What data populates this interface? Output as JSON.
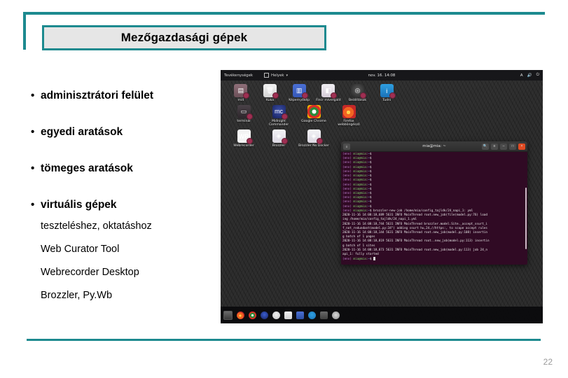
{
  "slide": {
    "title": "Mezőgazdasági gépek",
    "page_number": "22",
    "accent_color": "#1d8a8f",
    "title_fill": "#e6e6e6"
  },
  "bullets": [
    {
      "marker": "•",
      "text": "adminisztrátori felület"
    },
    {
      "marker": "•",
      "text": "egyedi aratások"
    },
    {
      "marker": "•",
      "text": "tömeges aratások"
    },
    {
      "marker": "•",
      "text": "virtuális gépek"
    }
  ],
  "sublines": [
    "teszteléshez, oktatáshoz",
    "Web Curator Tool",
    "Webrecorder Desktop",
    "Brozzler, Py.Wb"
  ],
  "screenshot": {
    "panel": {
      "activities": "Tevékenységek",
      "places": "Helyek",
      "places_icon": "folder-icon",
      "caret": "▾",
      "clock": "nov. 16. 14:08",
      "accessibility_icon": "A",
      "volume_icon": "🔊",
      "power_icon": "⏻"
    },
    "desktop_icons": [
      [
        {
          "label": "mi4",
          "glyph_class": "g-folder",
          "icon": "folder-icon",
          "symbol": "▤"
        },
        {
          "label": "Kuka",
          "glyph_class": "g-trash",
          "icon": "trash-icon",
          "symbol": "🗑"
        },
        {
          "label": "Képernyőkép",
          "glyph_class": "g-screen",
          "icon": "screenshot-icon",
          "symbol": "▥"
        },
        {
          "label": "Fincr mlvergalit",
          "glyph_class": "g-find",
          "icon": "find-icon",
          "symbol": "◧"
        },
        {
          "label": "Beállítások",
          "glyph_class": "g-settings",
          "icon": "settings-icon",
          "symbol": "◎"
        },
        {
          "label": "Tudni",
          "glyph_class": "g-info",
          "icon": "info-icon",
          "symbol": "i"
        }
      ],
      [
        {
          "label": "terminál",
          "glyph_class": "g-term",
          "icon": "terminal-icon",
          "symbol": "▭"
        },
        {
          "label": "Midnight Commander",
          "glyph_class": "g-mc",
          "icon": "midnight-commander-icon",
          "symbol": "mc"
        },
        {
          "label": "Google Chrome",
          "glyph_class": "g-chrome",
          "icon": "chrome-icon",
          "symbol": ""
        },
        {
          "label": "Firefox webböngésző",
          "glyph_class": "g-fox",
          "icon": "firefox-icon",
          "symbol": ""
        }
      ],
      [
        {
          "label": "Webrecorder",
          "glyph_class": "g-wr",
          "icon": "webrecorder-icon",
          "symbol": "WR"
        },
        {
          "label": "Brozzler",
          "glyph_class": "g-broz",
          "icon": "brozzler-icon",
          "symbol": "◈"
        },
        {
          "label": "Brozzler No Docker",
          "glyph_class": "g-broz",
          "icon": "brozzler-nodocker-icon",
          "symbol": "◈"
        }
      ]
    ],
    "terminal": {
      "title": "mia@mia: ~",
      "menu_icon": "hamburger-icon",
      "search_icon": "🔍",
      "minimize_label": "–",
      "maximize_label": "□",
      "close_label": "×",
      "prompt": "(env) mia@mia:~$",
      "lines": [
        "(env) mia@mia:~$ ",
        "(env) mia@mia:~$ ",
        "(env) mia@mia:~$ ",
        "(env) mia@mia:~$ ",
        "(env) mia@mia:~$ ",
        "(env) mia@mia:~$ ",
        "(env) mia@mia:~$ ",
        "(env) mia@mia:~$ ",
        "(env) mia@mia:~$ ",
        "(env) mia@mia:~$ ",
        "(env) mia@mia:~$ ",
        "(env) mia@mia:~$ ",
        "(env) mia@mia:~$ ",
        "(env) mia@mia:~$ brozzler-new-job /home/mia/config_tajldk/24_napi_1: yml",
        "2020-11-16 14:08:18,689 5631 INFO MainThread root.new_job(file(model.py:76) load",
        "ing /home/mia/config_tajldk/24_napi_1.yml",
        "2020-11-16 14:08:18,744 5631 INFO MainThread brozzler.model.Site._accept_ssurt_i",
        "f_not_redundant(model.py:34\") adding ssurt hu,24,//https:, to scope accept rules",
        "2020-11-16 14:08:18,144 5631 INFO MainThread root.new_job(model.py:108) insertin",
        "g batch of 1 pages",
        "2020-11-16 14:08:18,819 5631 INFO MainThread root..new_job(model.py:113) insertin",
        "g batch of 1 sites",
        "2020-11-16 14:08:18,873 5631 INFO MainThread root.new_job(model.py:113) job 24_n",
        "api_1: fully started",
        "(env) mia@mia:~$ "
      ]
    },
    "dock_items": [
      {
        "name": "show-applications",
        "class": "showapps",
        "symbol": "⠿"
      },
      {
        "name": "firefox",
        "class": "d-fox",
        "symbol": ""
      },
      {
        "name": "chrome",
        "class": "d-chrome",
        "symbol": ""
      },
      {
        "name": "thunderbird",
        "class": "d-mail",
        "symbol": ""
      },
      {
        "name": "disks",
        "class": "d-disk",
        "symbol": ""
      },
      {
        "name": "files",
        "class": "d-files",
        "symbol": ""
      },
      {
        "name": "text-editor",
        "class": "d-edit",
        "symbol": ""
      },
      {
        "name": "help",
        "class": "d-help",
        "symbol": ""
      },
      {
        "name": "software",
        "class": "d-soft",
        "symbol": ""
      },
      {
        "name": "settings",
        "class": "d-settings",
        "symbol": ""
      }
    ]
  }
}
